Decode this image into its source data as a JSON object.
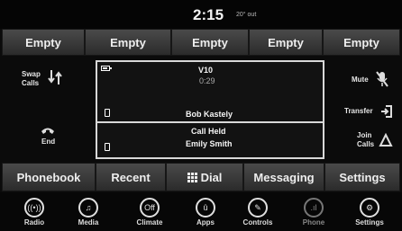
{
  "status": {
    "time": "2:15",
    "temperature": "20° out"
  },
  "favorites": [
    "Empty",
    "Empty",
    "Empty",
    "Empty",
    "Empty"
  ],
  "left_controls": {
    "swap_label": "Swap",
    "calls_label": "Calls",
    "end_label": "End"
  },
  "active_call": {
    "name_top": "V10",
    "duration": "0:29",
    "caller": "Bob Kastely",
    "battery_level": 0.75
  },
  "held_call": {
    "status": "Call Held",
    "caller": "Emily Smith"
  },
  "right_controls": {
    "mute_label": "Mute",
    "transfer_label": "Transfer",
    "join_label": "Join",
    "join_calls_label": "Calls"
  },
  "bottom_tabs": {
    "phonebook": "Phonebook",
    "recent": "Recent",
    "dial": "Dial",
    "messaging": "Messaging",
    "settings": "Settings"
  },
  "dock": [
    {
      "label": "Radio",
      "icon": "radio-icon"
    },
    {
      "label": "Media",
      "icon": "media-icon"
    },
    {
      "label": "Climate",
      "icon": "climate-icon",
      "glyph": "Off"
    },
    {
      "label": "Apps",
      "icon": "apps-icon"
    },
    {
      "label": "Controls",
      "icon": "controls-icon"
    },
    {
      "label": "Phone",
      "icon": "phone-icon"
    },
    {
      "label": "Settings",
      "icon": "settings-icon"
    }
  ]
}
